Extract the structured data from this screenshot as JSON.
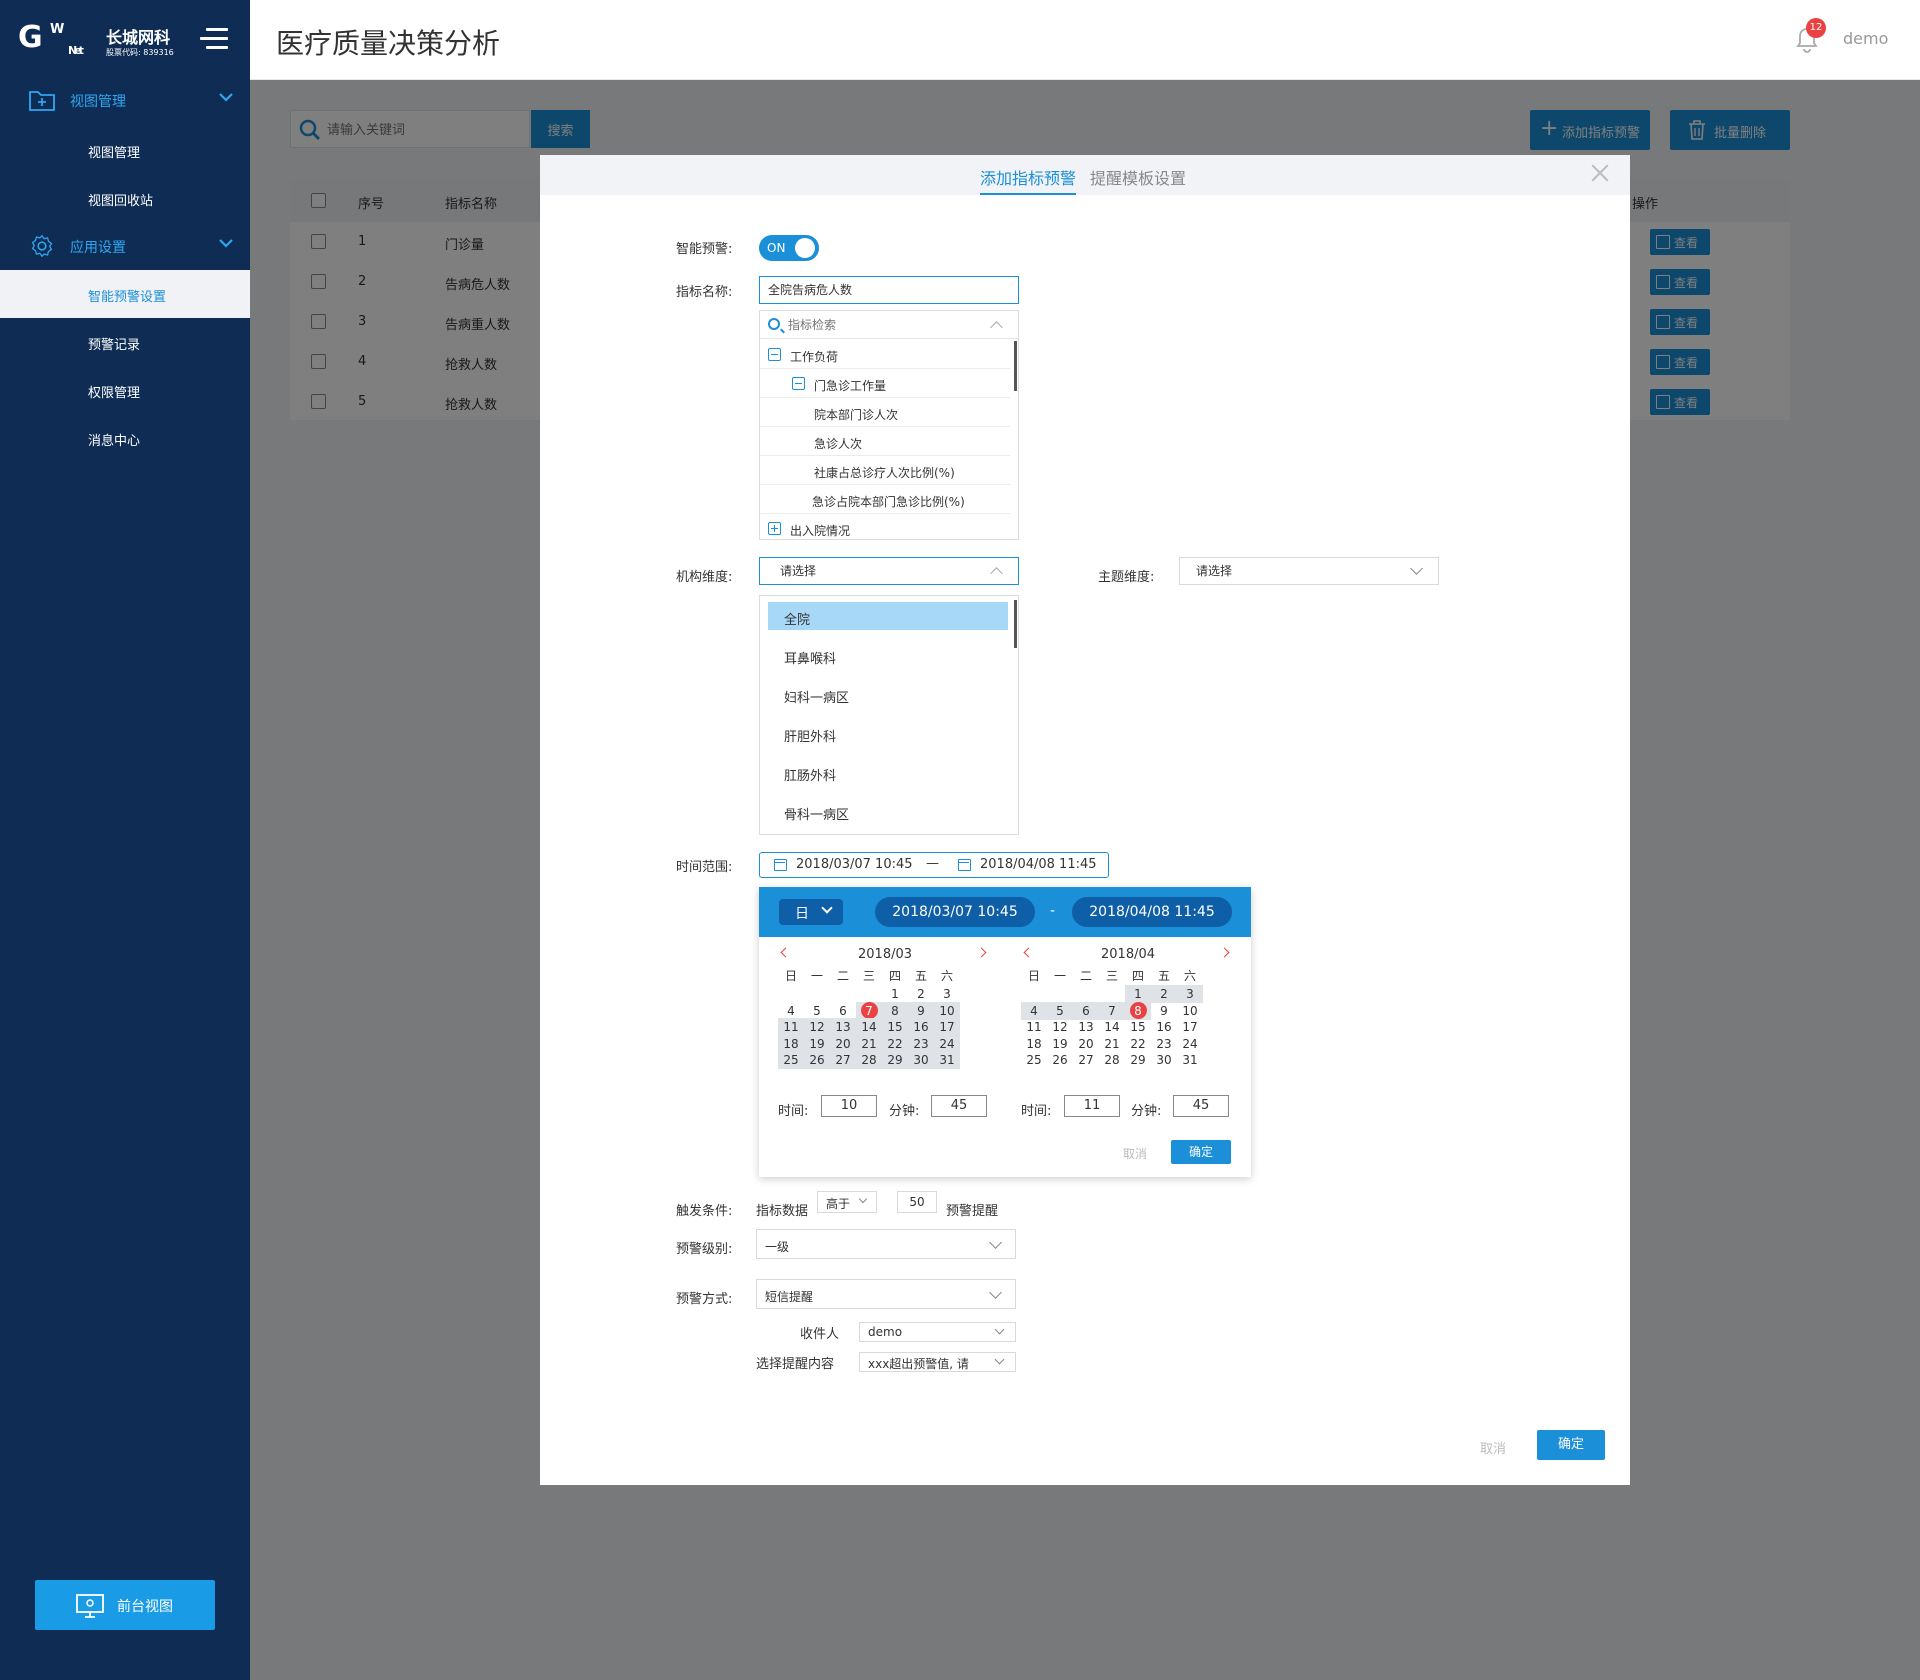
{
  "brand": {
    "logo_mark": "G",
    "logo_w": "W",
    "logo_net": "Net",
    "company": "长城网科",
    "stock": "股票代码: 839316"
  },
  "sidebar": {
    "groups": [
      {
        "label": "视图管理",
        "icon": "folder-plus-icon",
        "items": [
          "视图管理",
          "视图回收站"
        ]
      },
      {
        "label": "应用设置",
        "icon": "gear-icon",
        "items": [
          "智能预警设置",
          "预警记录",
          "权限管理",
          "消息中心"
        ]
      }
    ],
    "active_item": "智能预警设置",
    "front_view_button": "前台视图"
  },
  "header": {
    "title": "医疗质量决策分析",
    "notification_count": "12",
    "username": "demo"
  },
  "toolbar": {
    "search_placeholder": "请输入关键词",
    "search_button": "搜索",
    "add_button": "添加指标预警",
    "batch_delete_button": "批量删除"
  },
  "table": {
    "columns": [
      "序号",
      "指标名称",
      "操作"
    ],
    "rows": [
      {
        "index": "1",
        "name": "门诊量",
        "action": "查看"
      },
      {
        "index": "2",
        "name": "告病危人数",
        "action": "查看"
      },
      {
        "index": "3",
        "name": "告病重人数",
        "action": "查看"
      },
      {
        "index": "4",
        "name": "抢救人数",
        "action": "查看"
      },
      {
        "index": "5",
        "name": "抢救人数",
        "action": "查看"
      }
    ]
  },
  "modal": {
    "tabs": [
      "添加指标预警",
      "提醒模板设置"
    ],
    "active_tab": "添加指标预警",
    "smart_alert_label": "智能预警:",
    "smart_alert_toggle": "ON",
    "indicator_label": "指标名称:",
    "indicator_value": "全院告病危人数",
    "tree_search_placeholder": "指标检索",
    "tree": [
      {
        "label": "工作负荷",
        "level": 0,
        "expanded": true
      },
      {
        "label": "门急诊工作量",
        "level": 1,
        "expanded": true
      },
      {
        "label": "院本部门诊人次",
        "level": 2
      },
      {
        "label": "急诊人次",
        "level": 2
      },
      {
        "label": "社康占总诊疗人次比例(%)",
        "level": 2
      },
      {
        "label": "急诊占院本部门急诊比例(%)",
        "level": 2
      },
      {
        "label": "出入院情况",
        "level": 0,
        "expanded": false
      }
    ],
    "org_label": "机构维度:",
    "org_placeholder": "请选择",
    "org_options": [
      "全院",
      "耳鼻喉科",
      "妇科一病区",
      "肝胆外科",
      "肛肠外科",
      "骨科一病区"
    ],
    "org_selected": "全院",
    "theme_label": "主题维度:",
    "theme_placeholder": "请选择",
    "time_label": "时间范围:",
    "time_start": "2018/03/07  10:45",
    "time_sep": "—",
    "time_end": "2018/04/08  11:45",
    "picker": {
      "mode": "日",
      "start": "2018/03/07  10:45",
      "end": "2018/04/08  11:45",
      "sep": "-",
      "weekdays": [
        "日",
        "一",
        "二",
        "三",
        "四",
        "五",
        "六"
      ],
      "months": [
        {
          "title": "2018/03",
          "first_weekday": 4,
          "days": 31,
          "today": 7,
          "range_from": 7,
          "range_to": 31
        },
        {
          "title": "2018/04",
          "first_weekday": 4,
          "days": 31,
          "today": 8,
          "range_from": 1,
          "range_to": 8
        }
      ],
      "hour_label": "时间:",
      "minute_label": "分钟:",
      "left_hour": "10",
      "left_minute": "45",
      "right_hour": "11",
      "right_minute": "45",
      "cancel": "取消",
      "confirm": "确定"
    },
    "trigger_label": "触发条件:",
    "trigger_metric": "指标数据",
    "trigger_op": "高于",
    "trigger_value": "50",
    "trigger_suffix": "预警提醒",
    "level_label": "预警级别:",
    "level_value": "一级",
    "method_label": "预警方式:",
    "method_value": "短信提醒",
    "recipient_label": "收件人",
    "recipient_value": "demo",
    "content_label": "选择提醒内容",
    "content_value": "xxx超出预警值, 请",
    "cancel": "取消",
    "confirm": "确定"
  },
  "colors": {
    "sidebar_bg": "#0f2d54",
    "accent": "#1b8fd8",
    "badge": "#e94242"
  }
}
